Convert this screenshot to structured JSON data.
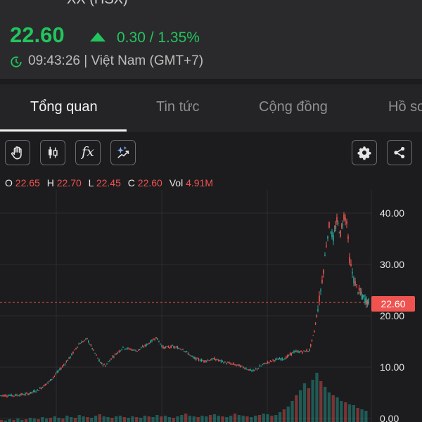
{
  "header": {
    "symbol_cut": "XX (HSX)",
    "price": "22.60",
    "change": "0.30 / 1.35%",
    "time": "09:43:26 | Việt Nam (GMT+7)"
  },
  "tabs": [
    {
      "label": "Tổng quan",
      "active": true
    },
    {
      "label": "Tin tức",
      "active": false
    },
    {
      "label": "Cộng đồng",
      "active": false
    },
    {
      "label": "Hồ sơ",
      "active": false
    }
  ],
  "toolbar": {
    "fx_label": "fx",
    "icons": [
      "hand-icon",
      "candlestick-icon",
      "function-icon",
      "ai-sparkle-icon",
      "gear-icon",
      "share-icon"
    ]
  },
  "ohlc": {
    "o_label": "O",
    "o": "22.65",
    "h_label": "H",
    "h": "22.70",
    "l_label": "L",
    "l": "22.45",
    "c_label": "C",
    "c": "22.60",
    "vol_label": "Vol",
    "vol": "4.91M"
  },
  "colors": {
    "up": "#22c55e",
    "down": "#ef5350",
    "candle_up": "#26a69a",
    "background": "#1c1c1e"
  },
  "chart_data": {
    "type": "line",
    "current_price_label": "22.60",
    "current_price": 22.6,
    "y_ticks": [
      "40.00",
      "30.00",
      "20.00",
      "10.00",
      "0.00"
    ],
    "y_tick_values": [
      40,
      30,
      20,
      10,
      0
    ],
    "ylim": [
      0,
      46
    ],
    "grid": true,
    "price_points": [
      [
        0,
        4.5
      ],
      [
        20,
        4.5
      ],
      [
        40,
        4.8
      ],
      [
        55,
        5.6
      ],
      [
        70,
        7.2
      ],
      [
        85,
        9.5
      ],
      [
        100,
        12.0
      ],
      [
        112,
        14.5
      ],
      [
        124,
        15.5
      ],
      [
        133,
        13.2
      ],
      [
        143,
        10.8
      ],
      [
        150,
        10.3
      ],
      [
        160,
        12.0
      ],
      [
        175,
        13.8
      ],
      [
        195,
        13.2
      ],
      [
        210,
        14.5
      ],
      [
        222,
        15.8
      ],
      [
        232,
        13.8
      ],
      [
        245,
        14.0
      ],
      [
        260,
        13.5
      ],
      [
        275,
        11.8
      ],
      [
        290,
        11.2
      ],
      [
        305,
        11.6
      ],
      [
        320,
        10.9
      ],
      [
        340,
        10.3
      ],
      [
        360,
        9.2
      ],
      [
        375,
        10.6
      ],
      [
        390,
        11.4
      ],
      [
        405,
        11.7
      ],
      [
        418,
        13.0
      ],
      [
        430,
        13.0
      ],
      [
        440,
        13.3
      ],
      [
        447,
        17.0
      ],
      [
        452,
        21.5
      ],
      [
        456,
        25.0
      ],
      [
        460,
        29.0
      ],
      [
        464,
        34.0
      ],
      [
        468,
        37.5
      ],
      [
        474,
        35.0
      ],
      [
        479,
        38.5
      ],
      [
        484,
        36.0
      ],
      [
        489,
        39.5
      ],
      [
        493,
        38.5
      ],
      [
        497,
        31.0
      ],
      [
        503,
        27.0
      ],
      [
        509,
        25.0
      ],
      [
        514,
        24.0
      ],
      [
        519,
        23.2
      ],
      [
        524,
        22.6
      ]
    ],
    "volume_heights": [
      3,
      2,
      4,
      3,
      5,
      3,
      4,
      6,
      5,
      4,
      7,
      5,
      6,
      8,
      6,
      5,
      9,
      7,
      6,
      10,
      8,
      7,
      6,
      9,
      11,
      8,
      7,
      6,
      8,
      9,
      7,
      6,
      8,
      7,
      6,
      9,
      8,
      7,
      10,
      8,
      9,
      7,
      6,
      8,
      10,
      12,
      9,
      8,
      7,
      9,
      8,
      10,
      11,
      9,
      8,
      7,
      9,
      12,
      10,
      9,
      8,
      7,
      9,
      10,
      12,
      11,
      9,
      10,
      14,
      18,
      22,
      30,
      38,
      45,
      55,
      48,
      60,
      70,
      58,
      50,
      42,
      38,
      35,
      30,
      28,
      25,
      24,
      20,
      18,
      16
    ]
  }
}
